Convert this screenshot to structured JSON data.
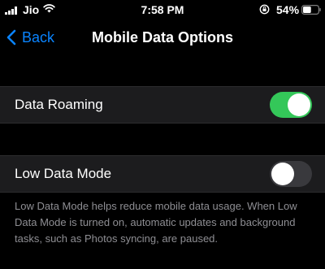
{
  "status_bar": {
    "carrier": "Jio",
    "time": "7:58 PM",
    "battery": "54%",
    "battery_level": 0.54,
    "icons": [
      "signal-icon",
      "wifi-icon",
      "orientation-lock-icon",
      "battery-icon"
    ]
  },
  "nav": {
    "back_label": "Back",
    "title": "Mobile Data Options"
  },
  "settings": [
    {
      "label": "Data Roaming",
      "enabled": true
    },
    {
      "label": "Low Data Mode",
      "enabled": false
    }
  ],
  "footer": "Low Data Mode helps reduce mobile data usage. When Low Data Mode is turned on, automatic updates and background tasks, such as Photos syncing, are paused.",
  "colors": {
    "accent": "#0a84ff",
    "toggle_on": "#34c759",
    "toggle_off": "#39393d",
    "background": "#000000",
    "cell_background": "#1c1c1e",
    "footer_text": "#8e8e93"
  }
}
